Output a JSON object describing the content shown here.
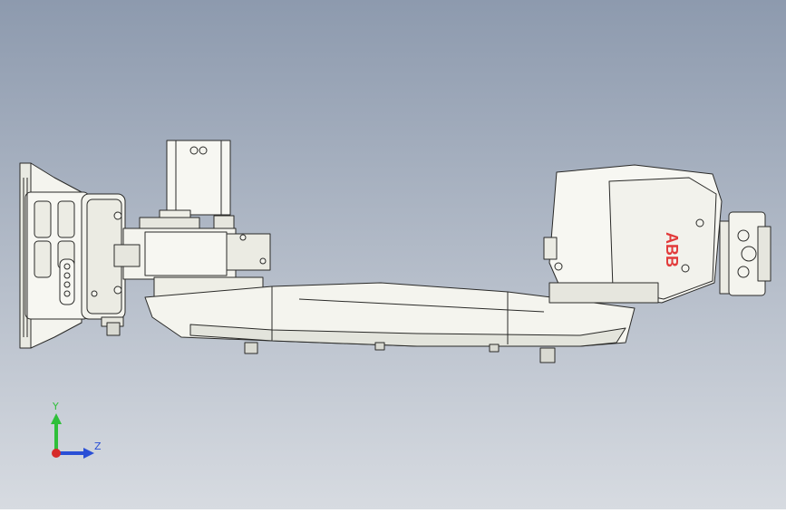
{
  "viewport": {
    "background_top": "#8d9aae",
    "background_bottom": "#d7dbe1"
  },
  "model": {
    "body_color": "#f4f4ee",
    "shade_color": "#d9dad2",
    "line_color": "#2a2a28",
    "logo_color": "#e23b3b",
    "logo_text": "ABB"
  },
  "triad": {
    "y_label": "Y",
    "z_label": "Z",
    "y_color": "#2fbf3a",
    "z_color": "#2a4fd6",
    "x_color": "#d62a2a"
  }
}
